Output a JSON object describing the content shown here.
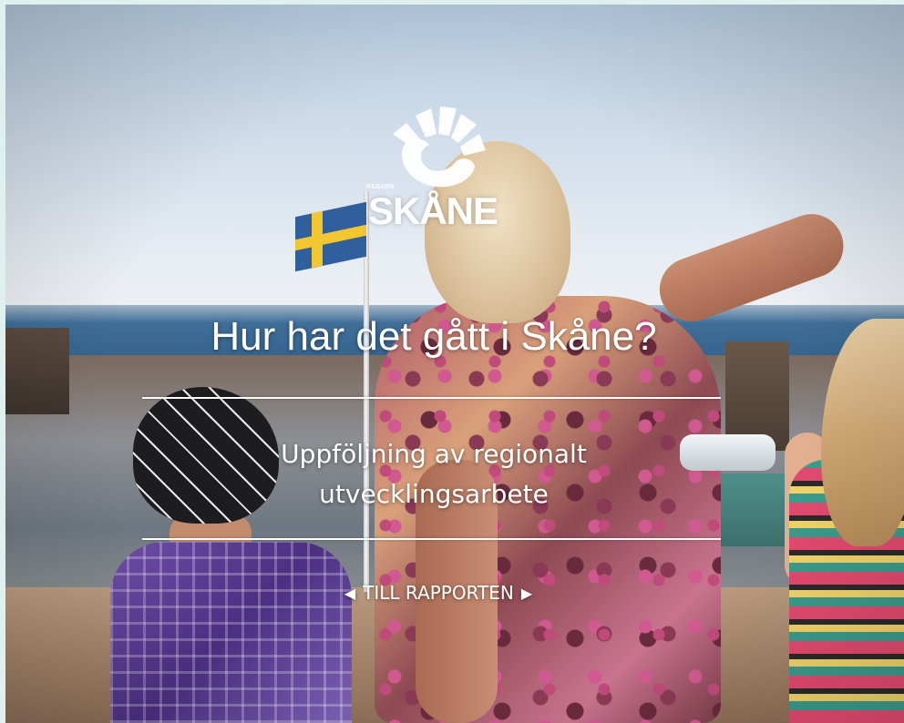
{
  "logo": {
    "region_label": "REGION",
    "wordmark": "SKÅNE",
    "icon": "sun-rays-logo-icon"
  },
  "hero": {
    "headline": "Hur har det gått i Skåne?",
    "subtitle_line1": "Uppföljning av regionalt",
    "subtitle_line2": "utvecklingsarbete",
    "cta_label": "TILL RAPPORTEN",
    "cta_left_icon": "triangle-left-icon",
    "cta_right_icon": "triangle-right-icon"
  },
  "colors": {
    "page_border": "#dff1ef",
    "overlay_text": "#ffffff",
    "flag_blue": "#2f5f9c",
    "flag_yellow": "#f2c631"
  }
}
